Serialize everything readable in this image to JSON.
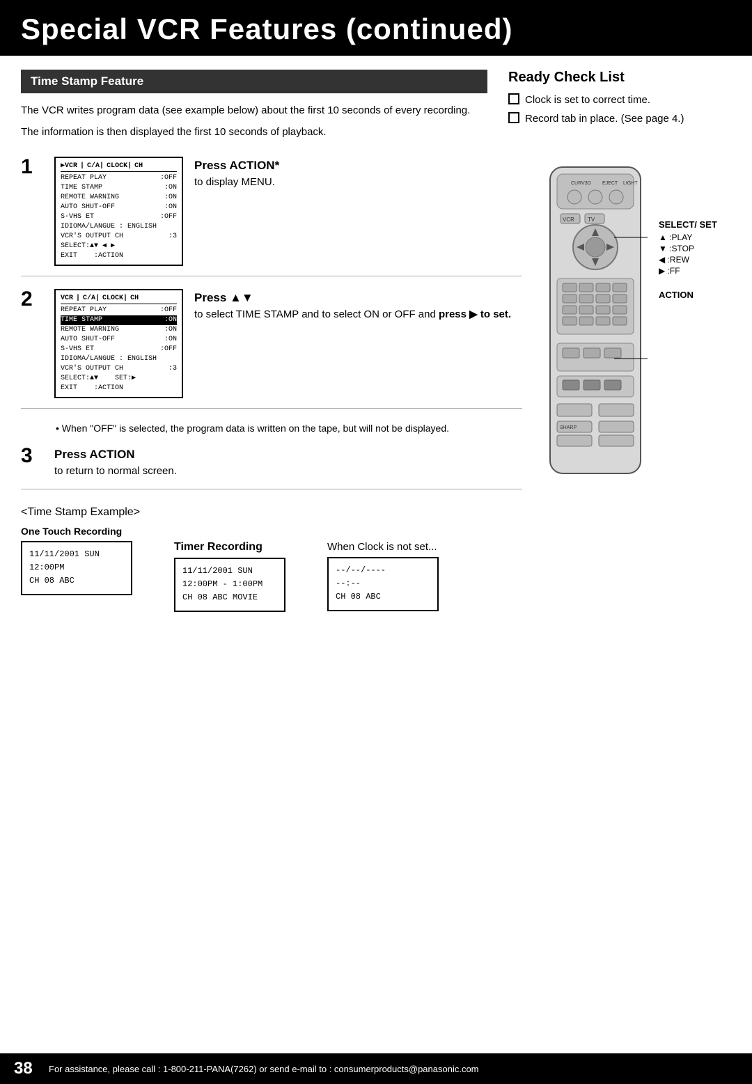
{
  "header": {
    "title": "Special VCR Features (continued)"
  },
  "time_stamp": {
    "section_title": "Time Stamp Feature",
    "intro1": "The VCR writes program data (see example below) about the first 10 seconds of every recording.",
    "intro2": "The information is then displayed the first 10 seconds of playback."
  },
  "ready_check": {
    "title": "Ready Check List",
    "items": [
      "Clock is set to correct time.",
      "Record tab in place. (See page 4.)"
    ]
  },
  "steps": [
    {
      "number": "1",
      "screen_lines": [
        "VCR | C/A| CLOCK | CH",
        "REPEAT PLAY   :OFF",
        "TIME STAMP    :ON",
        "REMOTE WARNING :ON",
        "AUTO SHUT-OFF  :ON",
        "S-VHS ET      :OFF",
        "IDIOMA/LANGUE : ENGLISH",
        "VCR'S OUTPUT CH :3",
        "SELECT:▲▼ ◀ ▶",
        "EXIT    :ACTION"
      ],
      "highlight_row": -1,
      "action_bold": "Press ACTION*",
      "action_rest": "to display MENU."
    },
    {
      "number": "2",
      "screen_lines": [
        "VCR | C/A| CLOCK | CH",
        "REPEAT PLAY   :OFF",
        "TIME STAMP    :ON",
        "REMOTE WARNING :ON",
        "AUTO SHUT-OFF  :ON",
        "S-VHS ET      :OFF",
        "IDIOMA/LANGUE : ENGLISH",
        "VCR'S OUTPUT CH :3",
        "SELECT:▲▼     SET:▶",
        "EXIT    :ACTION"
      ],
      "highlight_row": 2,
      "action_bold": "Press ▲▼",
      "action_rest": "to select TIME STAMP and to select ON or OFF and press ▶ to set."
    },
    {
      "number": "3",
      "screen_lines": [],
      "highlight_row": -1,
      "action_bold": "Press ACTION",
      "action_rest": "to return to normal screen."
    }
  ],
  "bullet_note": "• When \"OFF\" is selected, the program data is written on the tape, but will not be displayed.",
  "remote": {
    "select_set_label": "SELECT/ SET",
    "play_label": "▲ :PLAY",
    "stop_label": "▼ :STOP",
    "rew_label": "◀ :REW",
    "ff_label": "▶ :FF",
    "action_label": "ACTION"
  },
  "example": {
    "section_label": "<Time Stamp Example>",
    "one_touch_label": "One Touch Recording",
    "one_touch_lines": [
      "11/11/2001 SUN",
      "12:00PM",
      "CH 08 ABC"
    ],
    "timer_label": "Timer Recording",
    "timer_lines": [
      "11/11/2001 SUN",
      "12:00PM - 1:00PM",
      "CH 08 ABC MOVIE"
    ],
    "when_label": "When Clock is not set...",
    "when_lines": [
      "--/--/----",
      "--:--",
      "CH 08 ABC"
    ]
  },
  "footer": {
    "page_number": "38",
    "text": "For assistance, please call : 1-800-211-PANA(7262) or send e-mail to : consumerproducts@panasonic.com"
  }
}
